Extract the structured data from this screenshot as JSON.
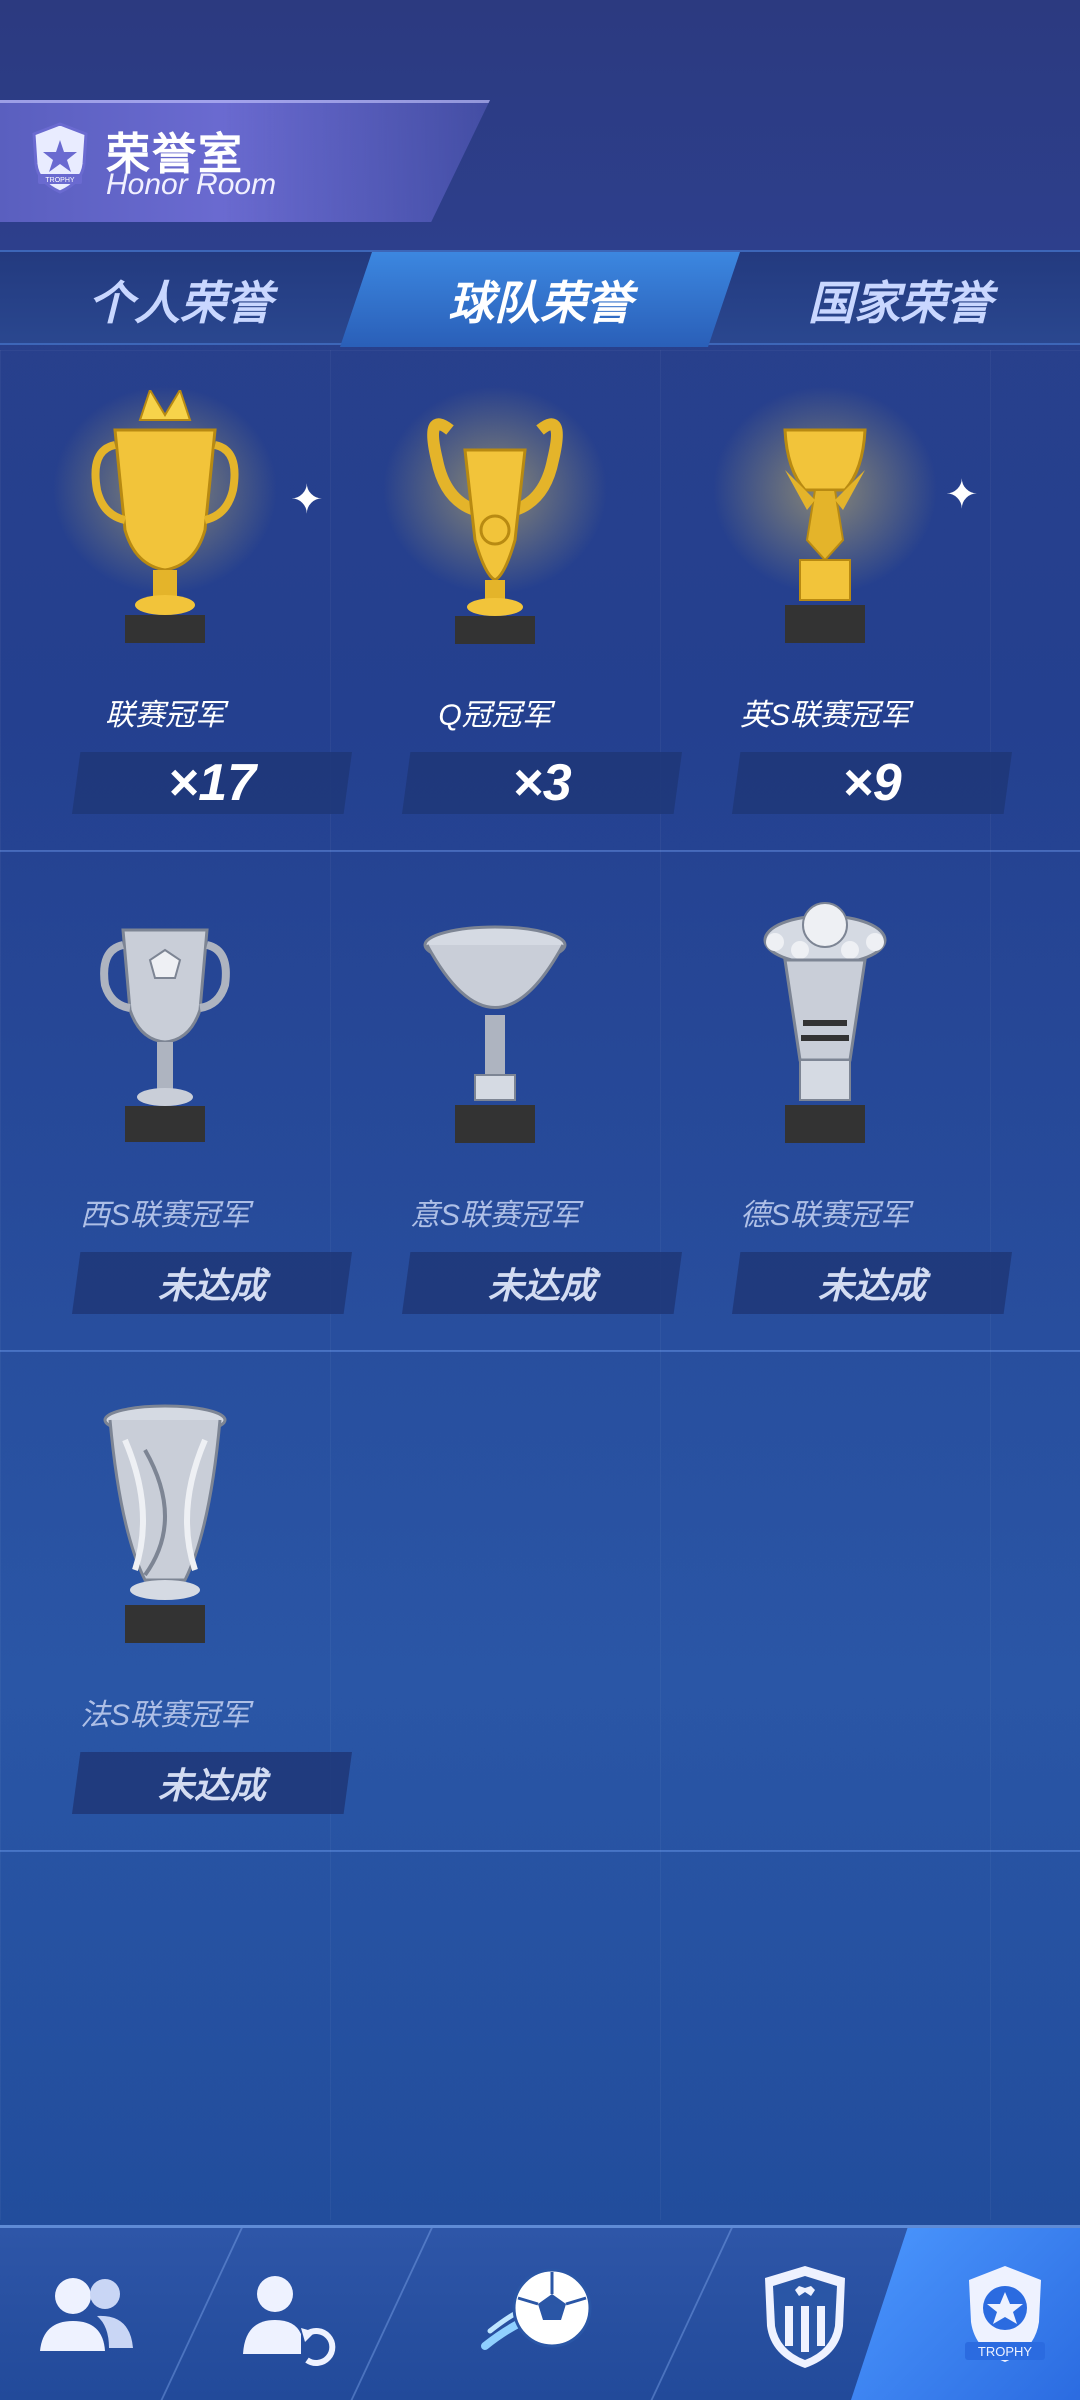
{
  "header": {
    "title": "荣誉室",
    "subtitle": "Honor Room",
    "emblem_text": "TROPHY"
  },
  "tabs": [
    {
      "label": "个人荣誉",
      "active": false
    },
    {
      "label": "球队荣誉",
      "active": true
    },
    {
      "label": "国家荣誉",
      "active": false
    }
  ],
  "trophies": [
    {
      "name": "联赛冠军",
      "count": "×17",
      "style": "gold"
    },
    {
      "name": "Q冠冠军",
      "count": "×3",
      "style": "gold"
    },
    {
      "name": "英S联赛冠军",
      "count": "×9",
      "style": "gold"
    },
    {
      "name": "西S联赛冠军",
      "count": "未达成",
      "style": "silver"
    },
    {
      "name": "意S联赛冠军",
      "count": "未达成",
      "style": "silver"
    },
    {
      "name": "德S联赛冠军",
      "count": "未达成",
      "style": "silver"
    },
    {
      "name": "法S联赛冠军",
      "count": "未达成",
      "style": "silver"
    }
  ],
  "bottom_nav": [
    {
      "icon": "players-icon",
      "active": false
    },
    {
      "icon": "transfer-icon",
      "active": false
    },
    {
      "icon": "match-ball-icon",
      "active": false
    },
    {
      "icon": "club-badge-icon",
      "active": false
    },
    {
      "icon": "trophy-badge-icon",
      "active": true,
      "label": "TROPHY"
    }
  ],
  "colors": {
    "accent": "#3c87e0",
    "gold": "#f2c43a",
    "silver": "#c9ced8",
    "background": "#24408f"
  }
}
